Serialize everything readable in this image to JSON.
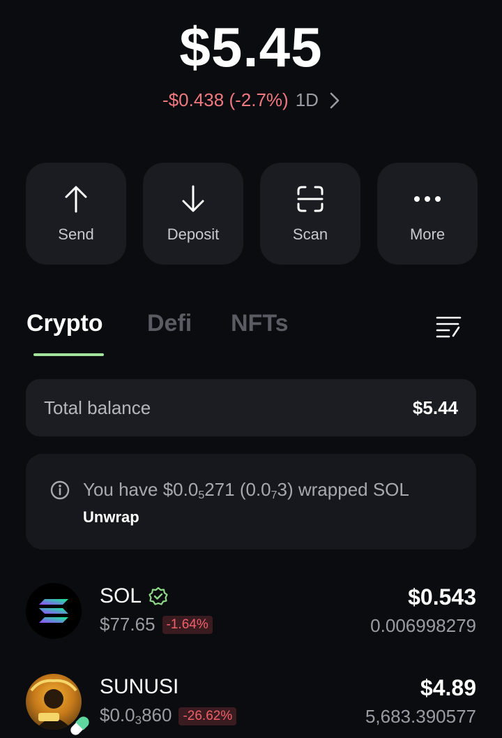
{
  "portfolio": {
    "balance": "$5.45",
    "change": "-$0.438 (-2.7%)",
    "period": "1D"
  },
  "actions": [
    {
      "label": "Send",
      "icon": "arrow-up-icon"
    },
    {
      "label": "Deposit",
      "icon": "arrow-down-icon"
    },
    {
      "label": "Scan",
      "icon": "scan-icon"
    },
    {
      "label": "More",
      "icon": "more-dots-icon"
    }
  ],
  "tabs": [
    {
      "label": "Crypto",
      "active": true
    },
    {
      "label": "Defi",
      "active": false
    },
    {
      "label": "NFTs",
      "active": false
    }
  ],
  "total_balance": {
    "label": "Total balance",
    "value": "$5.44"
  },
  "wrapped_notice": {
    "prefix": "You have $0.0",
    "sub1": "5",
    "mid": "271 (0.0",
    "sub2": "7",
    "suffix": "3) wrapped SOL",
    "action": "Unwrap"
  },
  "tokens": [
    {
      "name": "SOL",
      "verified": true,
      "price": "$77.65",
      "change": "-1.64%",
      "usd_value": "$0.543",
      "amount": "0.006998279"
    },
    {
      "name": "SUNUSI",
      "verified": false,
      "price_prefix": "$0.0",
      "price_sub": "3",
      "price_suffix": "860",
      "change": "-26.62%",
      "usd_value": "$4.89",
      "amount": "5,683.390577"
    }
  ],
  "colors": {
    "background": "#0b0c10",
    "card": "#1b1c21",
    "accent_green": "#a3e39b",
    "negative": "#f0787f"
  }
}
